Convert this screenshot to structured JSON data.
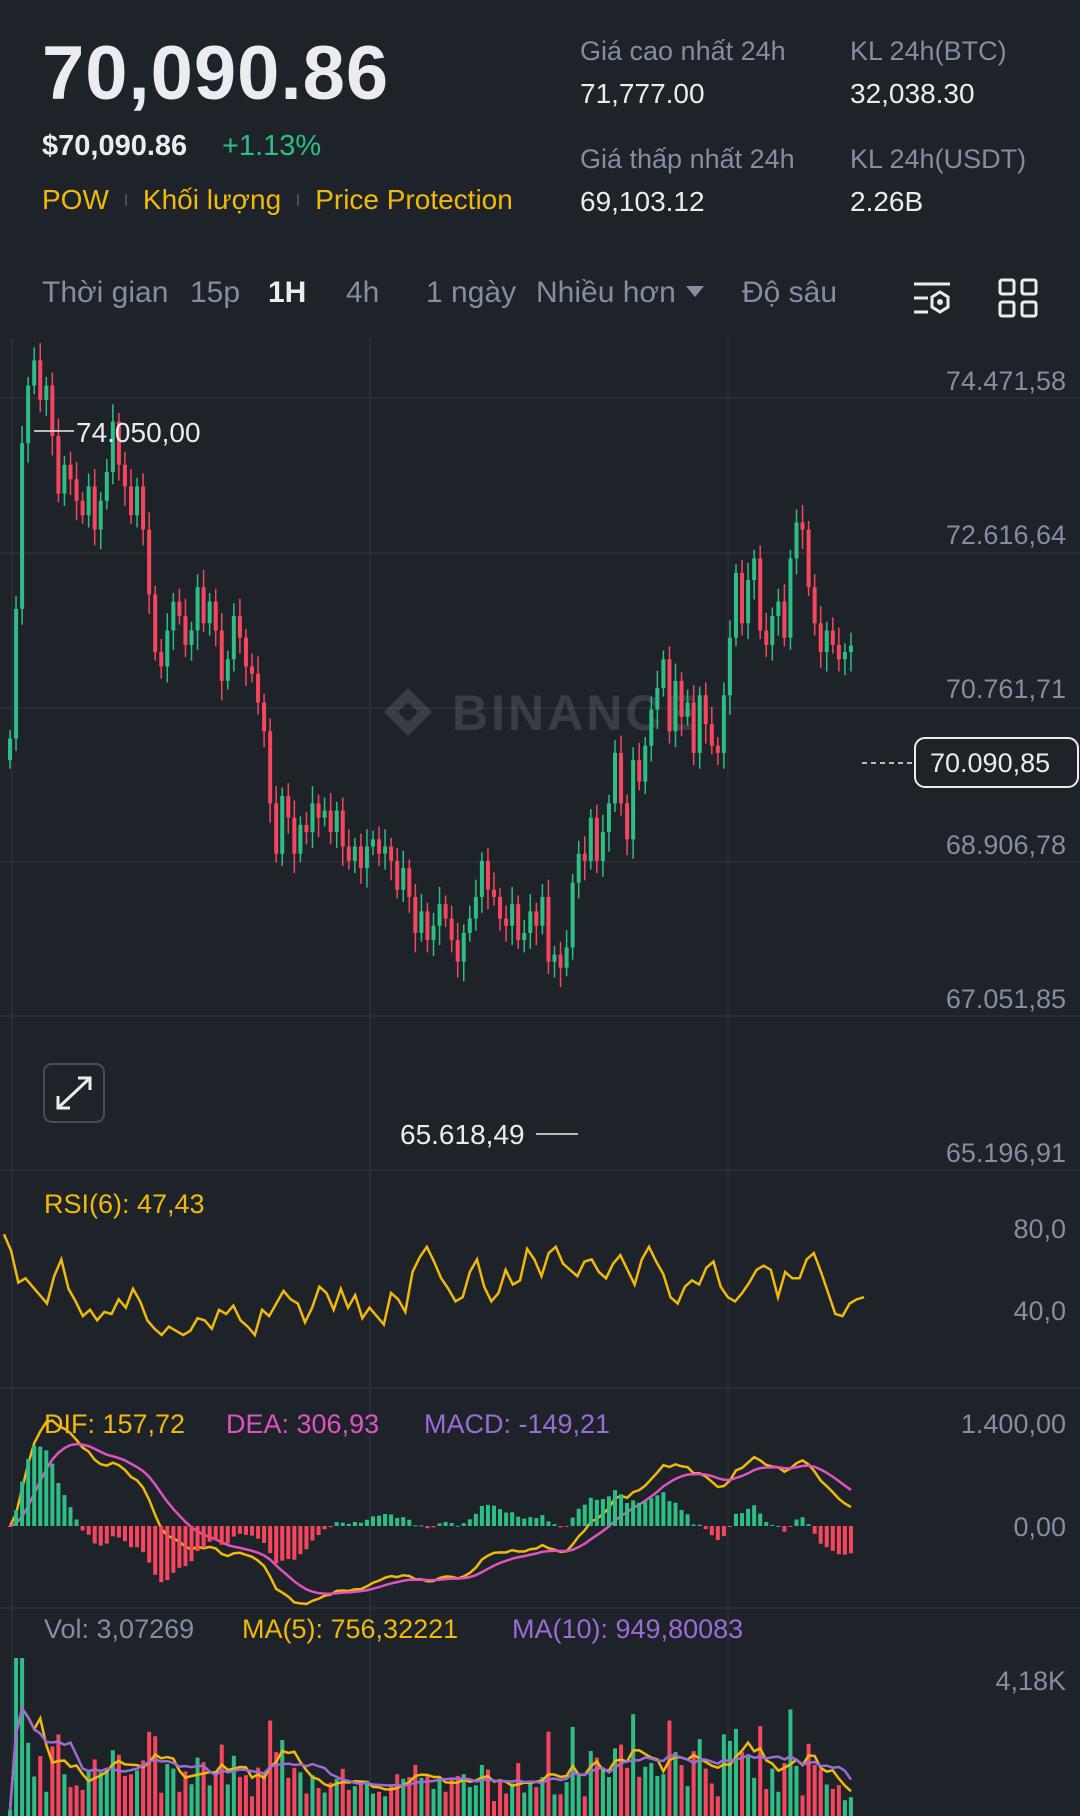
{
  "header": {
    "last_price": "70,090.86",
    "usd_price": "$70,090.86",
    "change_pct": "+1.13%",
    "tags": [
      "POW",
      "Khối lượng",
      "Price Protection"
    ]
  },
  "stats": {
    "high_label": "Giá cao nhất 24h",
    "high_value": "71,777.00",
    "low_label": "Giá thấp nhất 24h",
    "low_value": "69,103.12",
    "vol_btc_label": "KL 24h(BTC)",
    "vol_btc_value": "32,038.30",
    "vol_usdt_label": "KL 24h(USDT)",
    "vol_usdt_value": "2.26B"
  },
  "tabs": {
    "time": "Thời gian",
    "t15": "15p",
    "t1h": "1H",
    "t4h": "4h",
    "t1d": "1 ngày",
    "more": "Nhiều hơn",
    "depth": "Độ sâu"
  },
  "chart": {
    "watermark": "BINANCE",
    "price_axis": [
      "74.471,58",
      "72.616,64",
      "70.761,71",
      "68.906,78",
      "67.051,85",
      "65.196,91"
    ],
    "high_marker": "74.050,00",
    "low_marker": "65.618,49",
    "current_price": "70.090,85"
  },
  "rsi": {
    "label": "RSI(6): 47,43",
    "axis": [
      "80,0",
      "40,0"
    ]
  },
  "macd": {
    "dif": "DIF: 157,72",
    "dea": "DEA: 306,93",
    "macd": "MACD: -149,21",
    "axis": [
      "1.400,00",
      "0,00"
    ]
  },
  "volume": {
    "vol": "Vol: 3,07269",
    "ma5": "MA(5): 756,32221",
    "ma10": "MA(10): 949,80083",
    "axis": "4,18K"
  },
  "colors": {
    "up": "#2ebd85",
    "down": "#f6465d",
    "accent": "#f0b90b",
    "pink": "#e052c1",
    "purple": "#9b6bd6"
  },
  "chart_data": {
    "type": "candlestick",
    "interval": "1H",
    "ylim": [
      65196.91,
      74471.58
    ],
    "closes": [
      68800,
      70600,
      72900,
      73700,
      74050,
      73500,
      73700,
      73000,
      72200,
      72600,
      72400,
      72100,
      71900,
      72300,
      71700,
      72100,
      72500,
      73200,
      72600,
      72300,
      71900,
      72300,
      71700,
      70800,
      70000,
      69800,
      70300,
      70700,
      70500,
      70100,
      70300,
      70900,
      70400,
      70700,
      70300,
      69600,
      69900,
      70500,
      70200,
      69800,
      69700,
      69300,
      68900,
      67900,
      67200,
      68000,
      67700,
      67200,
      67600,
      67500,
      67900,
      67700,
      67800,
      67500,
      67800,
      67300,
      67100,
      67300,
      67000,
      67300,
      67400,
      67200,
      67300,
      67100,
      66700,
      67000,
      66600,
      66100,
      66400,
      66000,
      66200,
      66500,
      66300,
      66000,
      65700,
      66100,
      66300,
      66600,
      67100,
      66700,
      66600,
      66300,
      66200,
      66500,
      66000,
      66100,
      66400,
      66200,
      66600,
      65700,
      65800,
      65618,
      65900,
      66800,
      67200,
      67100,
      67700,
      67100,
      67500,
      67900,
      68600,
      67900,
      67400,
      68500,
      68200,
      68700,
      69200,
      69500,
      69900,
      68900,
      69600,
      69100,
      69300,
      68600,
      69400,
      69000,
      68700,
      68600,
      69400,
      70200,
      71100,
      70400,
      71000,
      71300,
      70300,
      70100,
      70500,
      70700,
      70200,
      71300,
      71800,
      71700,
      70900,
      70400,
      70000,
      70300,
      70100,
      69900,
      70000,
      70090
    ],
    "rsi": [
      78,
      70,
      55,
      57,
      53,
      49,
      45,
      58,
      66,
      52,
      46,
      39,
      42,
      37,
      41,
      40,
      47,
      43,
      52,
      46,
      37,
      33,
      30,
      34,
      32,
      30,
      32,
      38,
      37,
      33,
      42,
      40,
      44,
      37,
      34,
      30,
      42,
      39,
      45,
      51,
      47,
      45,
      36,
      43,
      53,
      50,
      42,
      52,
      43,
      49,
      38,
      43,
      39,
      35,
      50,
      47,
      41,
      60,
      67,
      72,
      65,
      57,
      52,
      46,
      48,
      60,
      66,
      53,
      46,
      50,
      61,
      54,
      56,
      71,
      66,
      58,
      69,
      72,
      64,
      61,
      58,
      65,
      66,
      60,
      57,
      64,
      68,
      61,
      54,
      66,
      72,
      65,
      59,
      48,
      45,
      53,
      56,
      54,
      62,
      65,
      53,
      48,
      46,
      50,
      55,
      61,
      63,
      61,
      48,
      60,
      57,
      57,
      66,
      69,
      60,
      50,
      40,
      39,
      45,
      47,
      48
    ],
    "macd_hist_sign": "positive early, negative mid-left, positive mid-right, negative at end",
    "volume_max": 4180
  }
}
